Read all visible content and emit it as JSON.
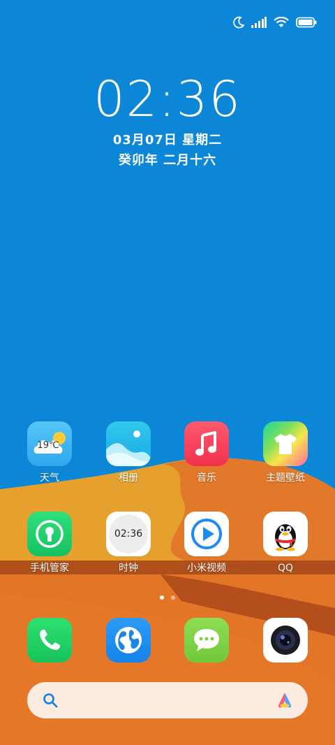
{
  "lock": {
    "time": "02:36",
    "date": "03月07日 星期二",
    "lunar": "癸卯年 二月十六"
  },
  "colors": {
    "sky": "#0c86d6",
    "dune_light": "#e5a02d",
    "dune_mid": "#e2782a",
    "dune_dark": "#b8531f",
    "search_bg": "#fbebe0"
  },
  "status_bar": {
    "icons": [
      "moon-icon",
      "signal-icon",
      "wifi-icon",
      "battery-icon"
    ]
  },
  "apps": [
    {
      "label": "天气",
      "icon": "weather-icon",
      "temp": "19℃"
    },
    {
      "label": "相册",
      "icon": "gallery-icon"
    },
    {
      "label": "音乐",
      "icon": "music-icon"
    },
    {
      "label": "主题壁纸",
      "icon": "themes-icon"
    },
    {
      "label": "手机管家",
      "icon": "security-icon"
    },
    {
      "label": "时钟",
      "icon": "clock-icon",
      "time": "02:36"
    },
    {
      "label": "小米视频",
      "icon": "video-icon"
    },
    {
      "label": "QQ",
      "icon": "qq-icon"
    }
  ],
  "dock": [
    {
      "icon": "phone-icon"
    },
    {
      "icon": "browser-icon"
    },
    {
      "icon": "messages-icon"
    },
    {
      "icon": "camera-icon"
    }
  ],
  "page_indicator": {
    "pages": 2,
    "current": 1
  },
  "search": {
    "icon": "search-icon",
    "assistant_icon": "assistant-icon"
  }
}
